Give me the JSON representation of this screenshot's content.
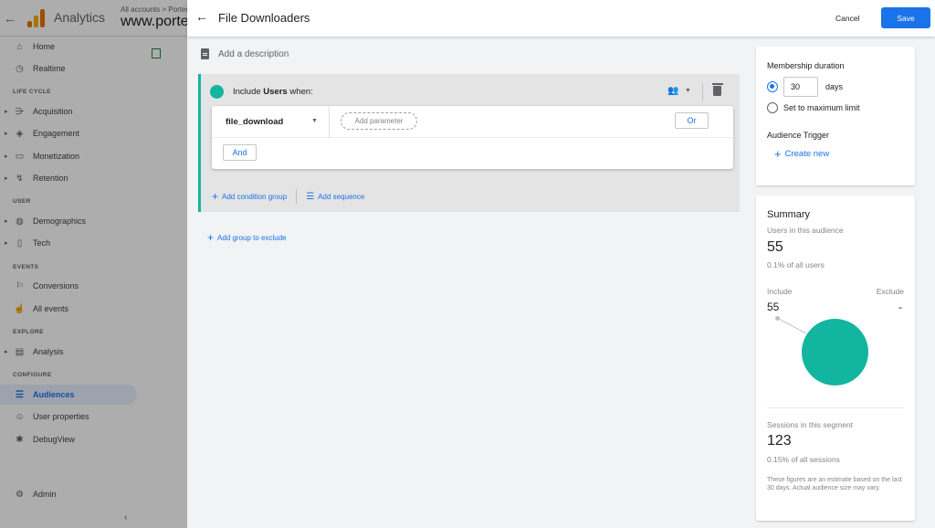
{
  "background": {
    "app_name": "Analytics",
    "breadcrumb": "All accounts > Porter",
    "property": "www.porter",
    "nav": {
      "items": [
        {
          "label": "Home",
          "icon": "home-icon"
        },
        {
          "label": "Realtime",
          "icon": "clock-icon"
        },
        {
          "label": "Acquisition",
          "icon": "acquisition-icon"
        },
        {
          "label": "Engagement",
          "icon": "tag-icon"
        },
        {
          "label": "Monetization",
          "icon": "card-icon"
        },
        {
          "label": "Retention",
          "icon": "retention-icon"
        },
        {
          "label": "Demographics",
          "icon": "globe-icon"
        },
        {
          "label": "Tech",
          "icon": "devices-icon"
        },
        {
          "label": "Conversions",
          "icon": "flag-icon"
        },
        {
          "label": "All events",
          "icon": "touch-icon"
        },
        {
          "label": "Analysis",
          "icon": "analysis-icon"
        },
        {
          "label": "Audiences",
          "icon": "audiences-icon"
        },
        {
          "label": "User properties",
          "icon": "person-icon"
        },
        {
          "label": "DebugView",
          "icon": "bug-icon"
        },
        {
          "label": "Admin",
          "icon": "gear-icon"
        }
      ],
      "sections": [
        "LIFE CYCLE",
        "USER",
        "EVENTS",
        "EXPLORE",
        "CONFIGURE"
      ]
    }
  },
  "header": {
    "title": "File Downloaders",
    "cancel_label": "Cancel",
    "save_label": "Save"
  },
  "description_placeholder": "Add a description",
  "include": {
    "prefix": "Include",
    "scope": "Users",
    "suffix": "when:",
    "event_name": "file_download",
    "add_parameter": "Add parameter",
    "or_label": "Or",
    "and_label": "And",
    "add_condition_group": "Add condition group",
    "add_sequence": "Add sequence"
  },
  "add_group_to_exclude": "Add group to exclude",
  "membership": {
    "title": "Membership duration",
    "days_value": "30",
    "days_label": "days",
    "max_label": "Set to maximum limit",
    "trigger_title": "Audience Trigger",
    "create_new": "Create new"
  },
  "summary": {
    "title": "Summary",
    "users_label": "Users in this audience",
    "users_value": "55",
    "users_pct": "0.1% of all users",
    "include_label": "Include",
    "exclude_label": "Exclude",
    "include_value": "55",
    "exclude_value": "-",
    "sessions_label": "Sessions in this segment",
    "sessions_value": "123",
    "sessions_pct": "0.15% of all sessions",
    "note": "These figures are an estimate based on the last 30 days. Actual audience size may vary."
  },
  "colors": {
    "accent": "#1a73e8",
    "teal": "#12b5a0"
  }
}
